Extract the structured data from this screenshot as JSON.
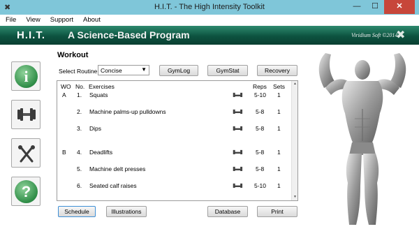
{
  "window": {
    "title": "H.I.T. - The High Intensity Toolkit",
    "minimize": "—",
    "maximize": "☐",
    "close": "✕"
  },
  "menu": [
    "File",
    "View",
    "Support",
    "About"
  ],
  "banner": {
    "app_name": "H.I.T.",
    "subtitle": "A Science-Based Program",
    "brand": "Viridium Soft ©2014"
  },
  "sidebar": [
    {
      "name": "info",
      "glyph": "i"
    },
    {
      "name": "dumbbell",
      "glyph": "🏋"
    },
    {
      "name": "nutrition",
      "glyph": "🍴"
    },
    {
      "name": "help",
      "glyph": "?"
    }
  ],
  "workout": {
    "heading": "Workout",
    "routine_label": "Select Routine:",
    "routine_value": "Concise",
    "buttons": {
      "gymlog": "GymLog",
      "gymstat": "GymStat",
      "recovery": "Recovery",
      "schedule": "Schedule",
      "illustrations": "Illustrations",
      "database": "Database",
      "print": "Print"
    },
    "columns": [
      "WO",
      "No.",
      "Exercises",
      "Reps",
      "Sets"
    ],
    "rows": [
      {
        "wo": "A",
        "no": "1.",
        "exercise": "Squats",
        "reps": "5-10",
        "sets": "1"
      },
      {
        "wo": "",
        "no": "2.",
        "exercise": "Machine palms-up pulldowns",
        "reps": "5-8",
        "sets": "1"
      },
      {
        "wo": "",
        "no": "3.",
        "exercise": "Dips",
        "reps": "5-8",
        "sets": "1"
      },
      {
        "wo": "B",
        "no": "4.",
        "exercise": "Deadlifts",
        "reps": "5-8",
        "sets": "1"
      },
      {
        "wo": "",
        "no": "5.",
        "exercise": "Machine delt presses",
        "reps": "5-8",
        "sets": "1"
      },
      {
        "wo": "",
        "no": "6.",
        "exercise": "Seated calf raises",
        "reps": "5-10",
        "sets": "1"
      }
    ]
  },
  "colors": {
    "titlebar": "#7fc6d9",
    "banner": "#0d5340",
    "accent_green": "#2f8d47",
    "close_button": "#c7463a"
  }
}
